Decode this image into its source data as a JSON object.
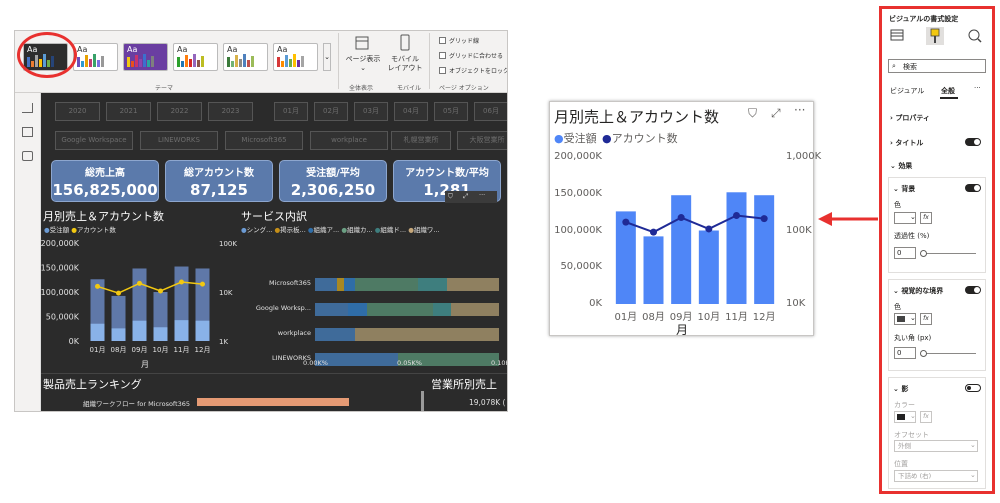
{
  "left": {
    "ribbon": {
      "theme_group": "テーマ",
      "page_view": "ページ表示",
      "view_all": "全体表示",
      "mobile_layout_1": "モバイル",
      "mobile_layout_2": "レイアウト",
      "mobile_group": "モバイル",
      "gridlines": "グリッド線",
      "snap_to_grid": "グリッドに合わせる",
      "lock_objects": "オブジェクトをロック",
      "page_options": "ページ オプション",
      "themes": [
        {
          "colors": [
            "#4472c4",
            "#ed7d31",
            "#a5a5a5",
            "#ffc000",
            "#5b9bd5",
            "#70ad47",
            "#264478"
          ]
        },
        {
          "colors": [
            "#6b4fbb",
            "#2e9ad0",
            "#e8a202",
            "#c23b75",
            "#38a169",
            "#7a6fe0",
            "#999999"
          ]
        },
        {
          "colors": [
            "#f2c811",
            "#e8501c",
            "#c9336b",
            "#8e44ad",
            "#3c6fce",
            "#2aa4a0",
            "#7f7f7f"
          ]
        },
        {
          "colors": [
            "#2ca02c",
            "#1f77b4",
            "#ff7f0e",
            "#d62728",
            "#9467bd",
            "#8c564b",
            "#bcbd22"
          ]
        },
        {
          "colors": [
            "#3a7a3a",
            "#72b372",
            "#d8b24a",
            "#8a8a8a",
            "#4f81bd",
            "#c0504d",
            "#9bbb59"
          ]
        },
        {
          "colors": [
            "#d63737",
            "#ff8c00",
            "#5b9bd5",
            "#70ad47",
            "#ffc000",
            "#7030a0",
            "#a5a5a5"
          ]
        }
      ]
    },
    "slicers_years": [
      "2020",
      "2021",
      "2022",
      "2023"
    ],
    "slicers_months": [
      "01月",
      "02月",
      "03月",
      "04月",
      "05月",
      "06月"
    ],
    "slicers_products": [
      "Google Workspace",
      "LINEWORKS",
      "Microsoft365",
      "workplace"
    ],
    "slicers_offices": [
      "札幌営業所",
      "大阪営業所"
    ],
    "kpis": [
      {
        "title": "総売上高",
        "value": "156,825,000"
      },
      {
        "title": "総アカウント数",
        "value": "87,125"
      },
      {
        "title": "受注額/平均",
        "value": "2,306,250"
      },
      {
        "title": "アカウント数/平均",
        "value": "1,281"
      }
    ],
    "monthly": {
      "title": "月別売上＆アカウント数",
      "legend_sales": "受注額",
      "legend_accounts": "アカウント数",
      "y_ticks": [
        "200,000K",
        "150,000K",
        "100,000K",
        "50,000K",
        "0K"
      ],
      "y2_ticks": [
        "100K",
        "10K",
        "1K"
      ],
      "months": [
        "01月",
        "08月",
        "09月",
        "10月",
        "11月",
        "12月"
      ],
      "x_title": "月"
    },
    "services": {
      "title": "サービス内訳",
      "legend": [
        "シング...",
        "掲示板...",
        "組織ア...",
        "組織カ...",
        "組織ド...",
        "組織ワ..."
      ],
      "legend_colors": [
        "#6b9ad3",
        "#c58f18",
        "#2f6da8",
        "#6b9f83",
        "#3e7e7e",
        "#c5a77a"
      ],
      "rows": [
        "Microsoft365",
        "Google Worksp...",
        "workplace",
        "LINEWORKS"
      ],
      "x_ticks": [
        "0.00K%",
        "0.05K%",
        "0.10K%"
      ]
    },
    "ranking": {
      "title": "製品売上ランキング",
      "item": "組織ワークフロー for Microsoft365"
    },
    "office": {
      "title": "営業所別売上",
      "value": "19,078K ("
    }
  },
  "card": {
    "title": "月別売上＆アカウント数",
    "legend_sales": "受注額",
    "legend_accounts": "アカウント数",
    "bar_color": "#4f86f7",
    "line_color": "#1f2a96",
    "chart_data": {
      "type": "bar",
      "title": "月別売上＆アカウント数",
      "xlabel": "月",
      "categories": [
        "01月",
        "08月",
        "09月",
        "10月",
        "11月",
        "12月"
      ],
      "series": [
        {
          "name": "受注額",
          "axis": "left",
          "values": [
            126000,
            92000,
            148000,
            100000,
            152000,
            148000
          ]
        },
        {
          "name": "アカウント数",
          "axis": "right-log",
          "values": [
            130,
            95,
            150,
            105,
            160,
            145
          ]
        }
      ],
      "ylim": [
        0,
        200000
      ],
      "y_ticks": [
        "200,000K",
        "150,000K",
        "100,000K",
        "50,000K",
        "0K"
      ],
      "y2_ticks": [
        "1,000K",
        "100K",
        "10K"
      ],
      "y2_log": true,
      "legend": "top-left"
    }
  },
  "pane": {
    "title": "ビジュアルの書式設定",
    "search_placeholder": "検索",
    "tab_visual": "ビジュアル",
    "tab_general": "全般",
    "more": "···",
    "properties": "プロパティ",
    "title_section": "タイトル",
    "effects": "効果",
    "background": "背景",
    "color": "色",
    "fx": "fx",
    "transparency": "透過性 (%)",
    "transparency_value": "0",
    "visual_border": "視覚的な境界",
    "border_color": "色",
    "radius": "丸い角 (px)",
    "radius_value": "0",
    "shadow": "影",
    "shadow_color": "カラー",
    "offset": "オフセット",
    "offset_value": "外側",
    "position": "位置",
    "position_value": "下詰め (右)"
  },
  "accent": "#e8312f"
}
